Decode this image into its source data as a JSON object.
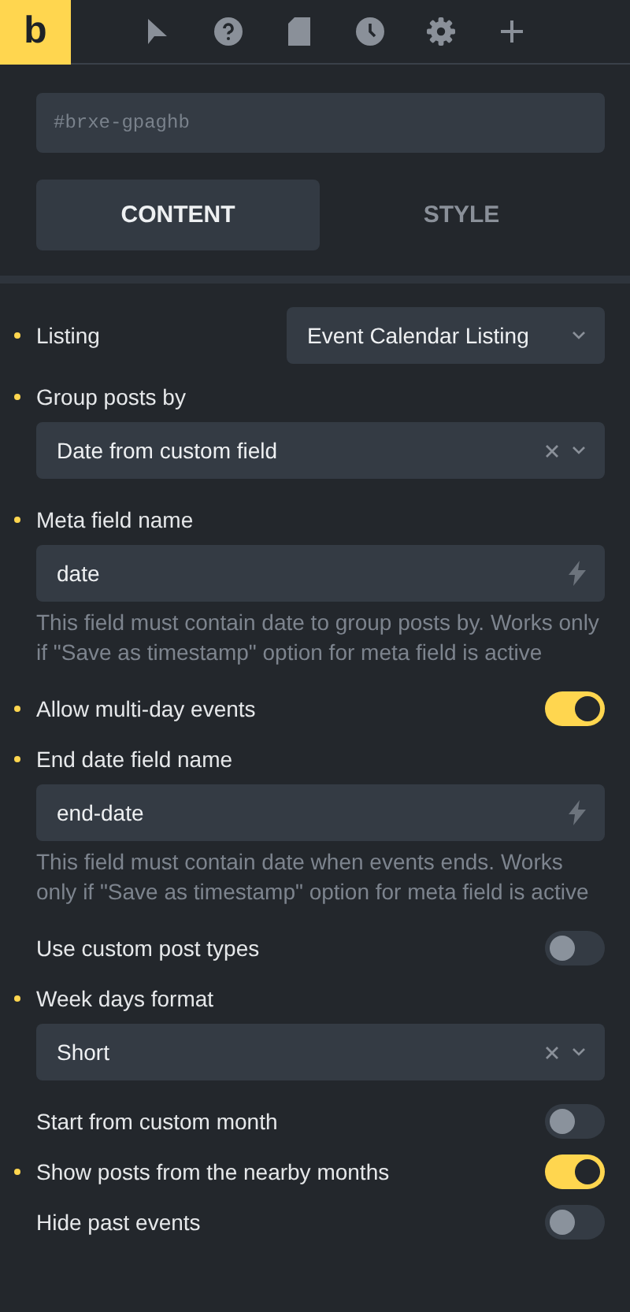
{
  "toolbar": {
    "logo": "b",
    "tools": [
      {
        "kind": "pointer",
        "selected": false
      },
      {
        "kind": "help",
        "selected": false
      },
      {
        "kind": "page",
        "selected": false
      },
      {
        "kind": "history",
        "selected": false
      },
      {
        "kind": "settings",
        "selected": false
      },
      {
        "kind": "add",
        "selected": false
      }
    ]
  },
  "id_field": {
    "placeholder": "#brxe-gpaghb"
  },
  "tabs": [
    {
      "label": "CONTENT",
      "selected": true
    },
    {
      "label": "STYLE",
      "selected": false
    }
  ],
  "controls": [
    {
      "kind": "inline_select",
      "label": "Listing",
      "modified": true,
      "value": "Event Calendar Listing"
    },
    {
      "kind": "select",
      "label": "Group posts by",
      "modified": true,
      "value": "Date from custom field"
    },
    {
      "kind": "text",
      "label": "Meta field name",
      "modified": true,
      "value": "date",
      "help": "This field must contain date to group posts by. Works only if \"Save as timestamp\" option for meta field is active"
    },
    {
      "kind": "toggle",
      "label": "Allow multi-day events",
      "modified": true,
      "on": true
    },
    {
      "kind": "text",
      "label": "End date field name",
      "modified": true,
      "value": "end-date",
      "help": "This field must contain date when events ends. Works only if \"Save as timestamp\" option for meta field is active"
    },
    {
      "kind": "toggle",
      "label": "Use custom post types",
      "modified": false,
      "on": false
    },
    {
      "kind": "select",
      "label": "Week days format",
      "modified": true,
      "value": "Short"
    },
    {
      "kind": "toggle",
      "label": "Start from custom month",
      "modified": false,
      "on": false
    },
    {
      "kind": "toggle",
      "label": "Show posts from the nearby months",
      "modified": true,
      "on": true
    },
    {
      "kind": "toggle",
      "label": "Hide past events",
      "modified": false,
      "on": false
    }
  ]
}
